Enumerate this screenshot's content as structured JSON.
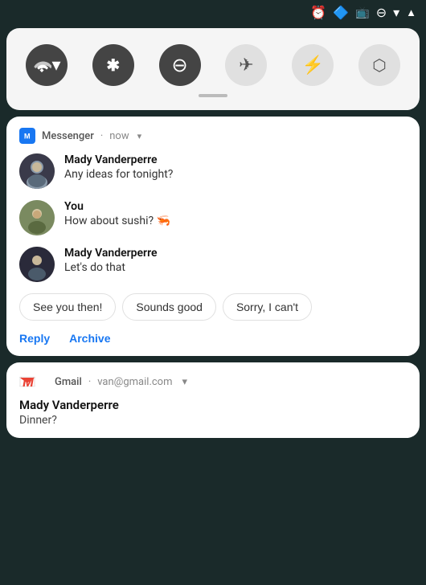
{
  "statusBar": {
    "icons": [
      "alarm",
      "bluetooth",
      "cast",
      "minus-circle",
      "wifi",
      "signal"
    ]
  },
  "quickSettings": {
    "buttons": [
      {
        "name": "wifi",
        "symbol": "▼",
        "active": true
      },
      {
        "name": "bluetooth",
        "symbol": "⬡",
        "active": true
      },
      {
        "name": "dnd",
        "symbol": "⊖",
        "active": true
      },
      {
        "name": "airplane",
        "symbol": "✈",
        "active": false
      },
      {
        "name": "flashlight",
        "symbol": "⚡",
        "active": false
      },
      {
        "name": "rotate",
        "symbol": "⬡",
        "active": false
      }
    ]
  },
  "messengerNotif": {
    "appName": "Messenger",
    "time": "now",
    "messages": [
      {
        "sender": "Mady Vanderperre",
        "text": "Any ideas for tonight?",
        "isSelf": false
      },
      {
        "sender": "You",
        "text": "How about sushi? 🦐",
        "isSelf": true
      },
      {
        "sender": "Mady Vanderperre",
        "text": "Let's do that",
        "isSelf": false
      }
    ],
    "quickReplies": [
      "See you then!",
      "Sounds good",
      "Sorry, I can't"
    ],
    "actions": [
      "Reply",
      "Archive"
    ]
  },
  "gmailNotif": {
    "appName": "Gmail",
    "account": "van@gmail.com",
    "sender": "Mady Vanderperre",
    "subject": "Dinner?"
  }
}
